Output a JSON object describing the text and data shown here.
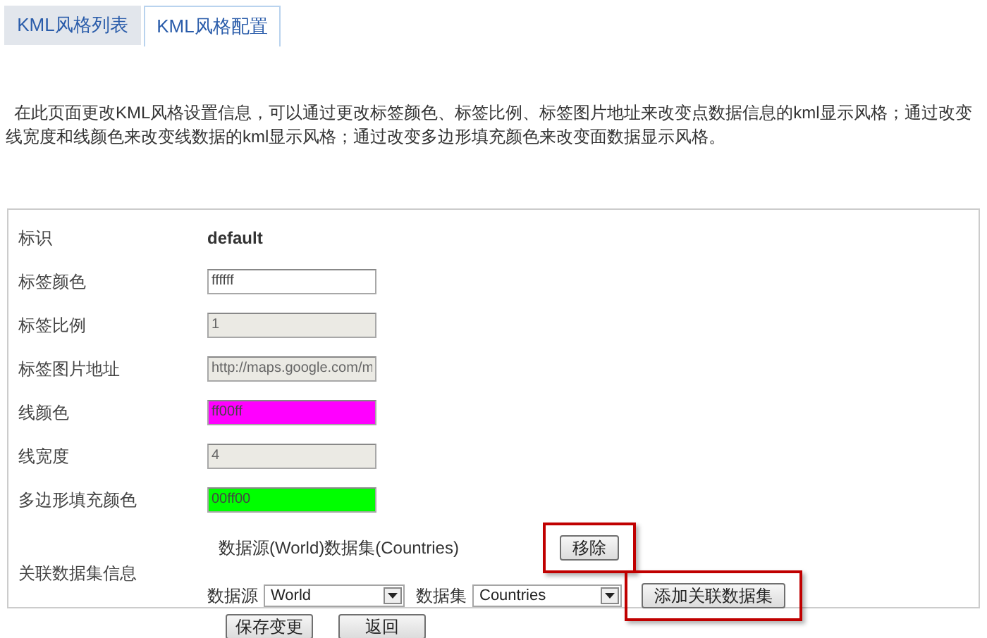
{
  "tabs": [
    {
      "label": "KML风格列表",
      "selected": false
    },
    {
      "label": "KML风格配置",
      "selected": true
    }
  ],
  "description": "在此页面更改KML风格设置信息，可以通过更改标签颜色、标签比例、标签图片地址来改变点数据信息的kml显示风格；通过改变线宽度和线颜色来改变线数据的kml显示风格；通过改变多边形填充颜色来改变面数据显示风格。",
  "fields": [
    {
      "kind": "static",
      "label": "标识",
      "value": "default"
    },
    {
      "kind": "input",
      "label": "标签颜色",
      "value": "ffffff",
      "disabled": false
    },
    {
      "kind": "input",
      "label": "标签比例",
      "value": "1",
      "disabled": true
    },
    {
      "kind": "input",
      "label": "标签图片地址",
      "value": "http://maps.google.com/m",
      "disabled": true
    },
    {
      "kind": "input",
      "label": "线颜色",
      "value": "ff00ff",
      "disabled": false,
      "color": "#ff00ff"
    },
    {
      "kind": "input",
      "label": "线宽度",
      "value": "4",
      "disabled": true
    },
    {
      "kind": "input",
      "label": "多边形填充颜色",
      "value": "00ff00",
      "disabled": false,
      "color": "#00ff00"
    }
  ],
  "related": {
    "label": "关联数据集信息",
    "current": "数据源(World)数据集(Countries)",
    "remove_button": {
      "label": "移除",
      "highlighted": true
    },
    "source_label": "数据源",
    "source_value": "World",
    "dataset_label": "数据集",
    "dataset_value": "Countries",
    "add_button": {
      "label": "添加关联数据集",
      "highlighted": true
    }
  },
  "buttons": [
    "保存变更",
    "返回"
  ]
}
